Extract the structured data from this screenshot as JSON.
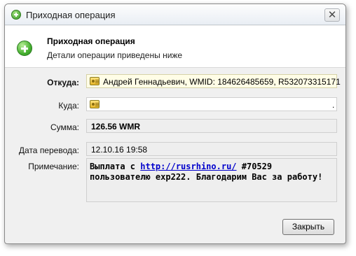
{
  "window": {
    "title": "Приходная операция",
    "close_glyph": "✕"
  },
  "header": {
    "title": "Приходная операция",
    "subtitle": "Детали операции приведены ниже"
  },
  "fields": {
    "from": {
      "label": "Откуда:",
      "value": "Андрей Геннадьевич, WMID: 184626485659, R532073315171"
    },
    "to": {
      "label": "Куда:",
      "value": "."
    },
    "amount": {
      "label": "Сумма:",
      "value": "126.56 WMR"
    },
    "date": {
      "label": "Дата перевода:",
      "value": "12.10.16 19:58"
    },
    "note": {
      "label": "Примечание:",
      "prefix": "Выплата с ",
      "link": "http://rusrhino.ru/",
      "suffix": " #70529 пользователю exp222. Благодарим Вас за работу!"
    }
  },
  "buttons": {
    "close": "Закрыть"
  }
}
